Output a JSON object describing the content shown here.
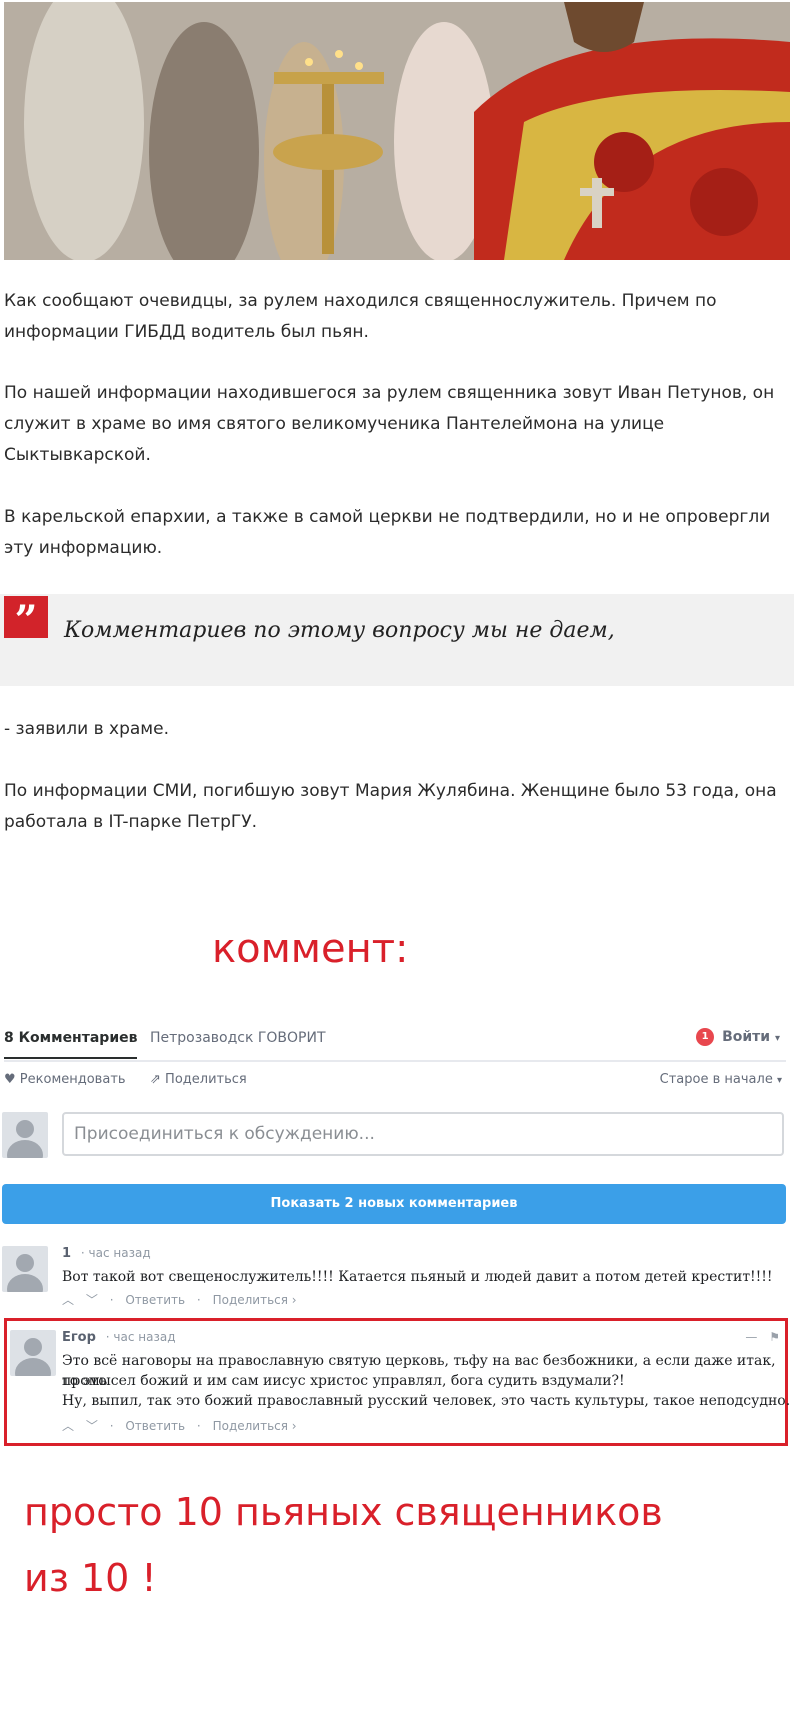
{
  "article": {
    "paragraphs": [
      "Как сообщают очевидцы, за рулем находился священнослужитель. Причем по информации ГИБДД водитель был пьян.",
      "По нашей информации находившегося за рулем священника зовут Иван Петунов, он служит в храме во имя святого великомученика Пантелеймона на улице Сыктывкарской.",
      "В карельской епархии, а также в самой церкви не подтвердили, но и не опровергли эту информацию.",
      "- заявили в храме.",
      "По информации СМИ, погибшую зовут Мария Жулябина. Женщине было 53 года, она работала в IT-парке ПетрГУ."
    ],
    "quote_mark": "”",
    "quote": "Комментариев по этому вопросу мы не даем,"
  },
  "annotations": {
    "comment_label": "коммент:",
    "footer_line1": "просто 10 пьяных священников",
    "footer_line2": "из 10 !"
  },
  "disqus": {
    "tab_comments": "8 Комментариев",
    "tab_forum": "Петрозаводск ГОВОРИТ",
    "notification_count": "1",
    "login_label": "Войти",
    "recommend_label": "Рекомендовать",
    "share_label": "Поделиться",
    "sort_label": "Старое в начале",
    "join_placeholder": "Присоединиться к обсуждению...",
    "show_new_button": "Показать 2 новых комментариев",
    "comments": [
      {
        "author": "1",
        "time": "час назад",
        "text_lines": [
          "Вот такой вот свещенослужитель!!!! Катается пьяный и людей давит а потом детей крестит!!!!"
        ],
        "reply": "Ответить",
        "share": "Поделиться ›"
      },
      {
        "author": "Егор",
        "time": "час назад",
        "text_lines": [
          "Это всё наговоры на православную святую церковь, тьфу на вас безбожники, а если даже итак, то это",
          "промысел божий и им сам иисус христос управлял, бога судить вздумали?!",
          "Ну, выпил, так это божий православный русский человек, это часть культуры, такое неподсудно."
        ],
        "reply": "Ответить",
        "share": "Поделиться ›"
      }
    ]
  },
  "colors": {
    "accent_red": "#d9202a",
    "button_blue": "#3b9fe8"
  }
}
